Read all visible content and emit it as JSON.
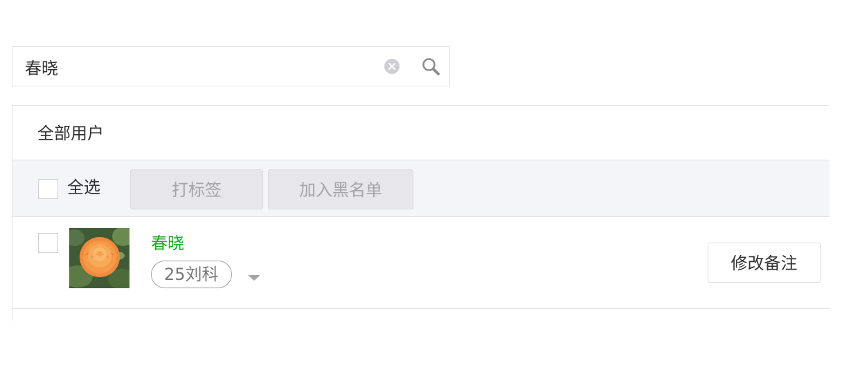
{
  "search": {
    "value": "春晓",
    "clear_icon": "clear-circle-icon",
    "search_icon": "magnifier-icon"
  },
  "panel": {
    "title": "全部用户"
  },
  "toolbar": {
    "select_all_label": "全选",
    "tag_button": "打标签",
    "blacklist_button": "加入黑名单"
  },
  "users": [
    {
      "name": "春晓",
      "tag": "25刘科",
      "remark_button": "修改备注",
      "avatar": "orange-rose-photo"
    }
  ],
  "colors": {
    "name_green": "#1aad19",
    "toolbar_bg": "#f4f5f9",
    "border": "#e3e3e5",
    "disabled_text": "#a3a3a8"
  }
}
